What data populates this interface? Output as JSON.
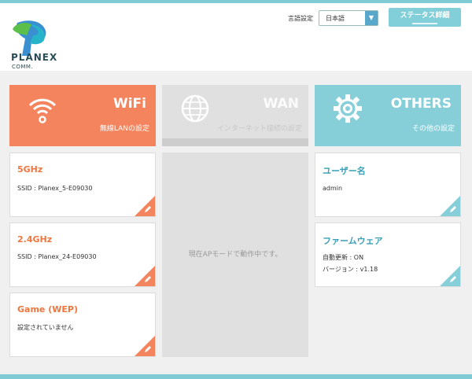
{
  "brand": {
    "name": "PLANEX",
    "sub": "COMM."
  },
  "header": {
    "lang_label": "言語設定",
    "lang_value": "日本語",
    "status_button": "ステータス詳細"
  },
  "tiles": {
    "wifi": {
      "title": "WiFi",
      "subtitle": "無線LANの設定",
      "icon": "wifi-icon"
    },
    "wan": {
      "title": "WAN",
      "subtitle": "インターネット接続の設定",
      "icon": "globe-icon"
    },
    "others": {
      "title": "OTHERS",
      "subtitle": "その他の設定",
      "icon": "gear-icon"
    }
  },
  "wifi_cards": [
    {
      "title": "5GHz",
      "line1": "SSID : Planex_5-E09030"
    },
    {
      "title": "2.4GHz",
      "line1": "SSID : Planex_24-E09030"
    },
    {
      "title": "Game (WEP)",
      "line1": "設定されていません"
    }
  ],
  "wan_panel": {
    "message": "現在APモードで動作中です。"
  },
  "others_cards": [
    {
      "title": "ユーザー名",
      "line1": "admin"
    },
    {
      "title": "ファームウェア",
      "line1": "自動更新 : ON",
      "line2": "バージョン : v1.18"
    }
  ],
  "colors": {
    "accent_orange": "#f4845d",
    "accent_teal": "#86cfd9",
    "disabled_gray": "#e0e0e0"
  }
}
